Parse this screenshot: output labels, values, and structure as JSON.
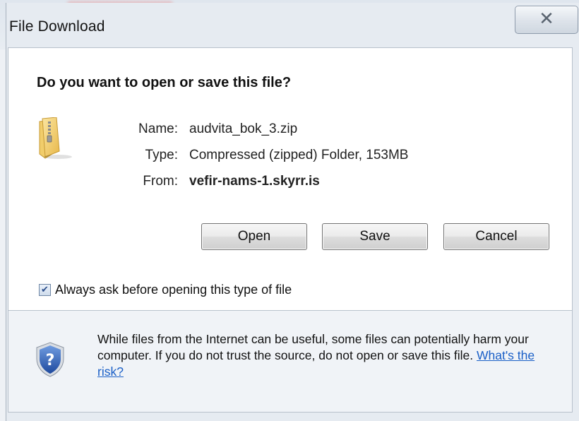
{
  "window": {
    "title": "File Download",
    "close_label": "✕"
  },
  "dialog": {
    "heading": "Do you want to open or save this file?",
    "file_icon": "zip-folder-icon",
    "fields": {
      "name_label": "Name:",
      "name_value": "audvita_bok_3.zip",
      "type_label": "Type:",
      "type_value": "Compressed (zipped) Folder, 153MB",
      "from_label": "From:",
      "from_value": "vefir-nams-1.skyrr.is"
    },
    "buttons": {
      "open": "Open",
      "save": "Save",
      "cancel": "Cancel"
    },
    "always_ask": {
      "checked": true,
      "label": "Always ask before opening this type of file"
    },
    "warning": {
      "icon": "shield-question-icon",
      "text": "While files from the Internet can be useful, some files can potentially harm your computer. If you do not trust the source, do not open or save this file.",
      "link": "What's the risk?"
    }
  },
  "colors": {
    "link": "#1a5fc7",
    "dialog_bg": "#ffffff",
    "footer_bg": "#f0f3f7",
    "shield_blue": "#2f5fb3"
  }
}
